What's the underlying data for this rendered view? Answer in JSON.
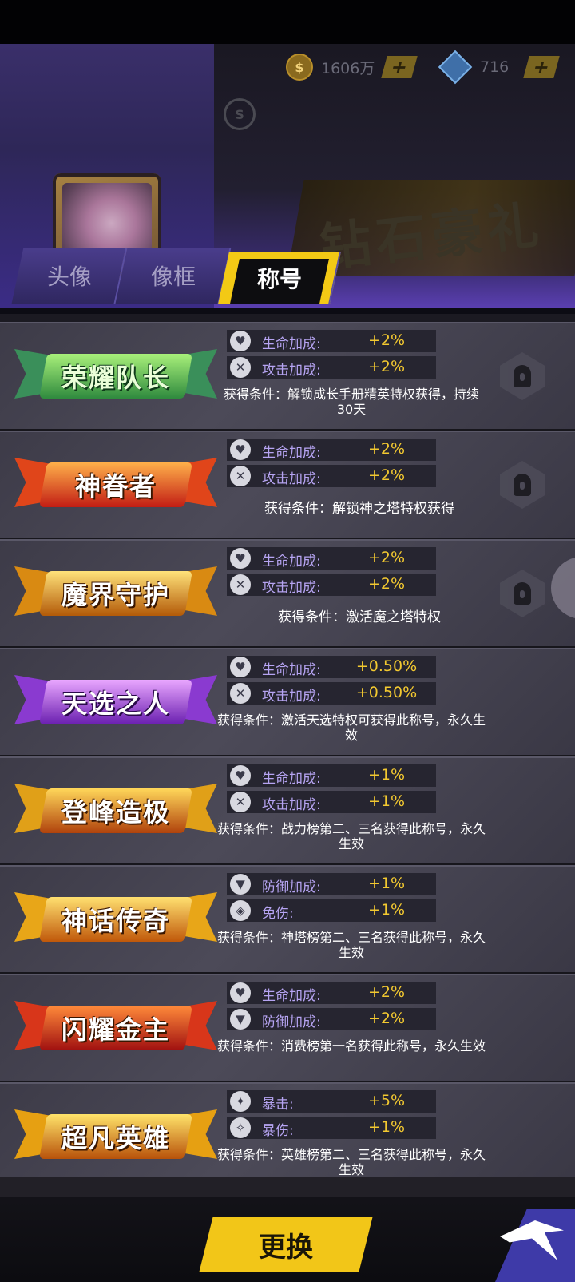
{
  "currency": {
    "coins": "1606万",
    "gems": "716",
    "s_icon": "S"
  },
  "banner": {
    "text": "钻石豪礼"
  },
  "tabs": [
    {
      "label": "头像",
      "active": false
    },
    {
      "label": "像框",
      "active": false
    },
    {
      "label": "称号",
      "active": true
    }
  ],
  "titles": [
    {
      "name": "荣耀队长",
      "locked": true,
      "stats": [
        {
          "icon": "shield-heart-icon",
          "label": "生命加成:",
          "value": "+2%"
        },
        {
          "icon": "crossed-swords-icon",
          "label": "攻击加成:",
          "value": "+2%"
        }
      ],
      "condition": "获得条件：解锁成长手册精英特权获得，持续30天"
    },
    {
      "name": "神眷者",
      "locked": true,
      "stats": [
        {
          "icon": "shield-heart-icon",
          "label": "生命加成:",
          "value": "+2%"
        },
        {
          "icon": "crossed-swords-icon",
          "label": "攻击加成:",
          "value": "+2%"
        }
      ],
      "condition": "获得条件：解锁神之塔特权获得"
    },
    {
      "name": "魔界守护",
      "locked": true,
      "stats": [
        {
          "icon": "shield-heart-icon",
          "label": "生命加成:",
          "value": "+2%"
        },
        {
          "icon": "crossed-swords-icon",
          "label": "攻击加成:",
          "value": "+2%"
        }
      ],
      "condition": "获得条件：激活魔之塔特权"
    },
    {
      "name": "天选之人",
      "locked": false,
      "stats": [
        {
          "icon": "shield-heart-icon",
          "label": "生命加成:",
          "value": "+0.50%"
        },
        {
          "icon": "crossed-swords-icon",
          "label": "攻击加成:",
          "value": "+0.50%"
        }
      ],
      "condition": "获得条件：激活天选特权可获得此称号，永久生效"
    },
    {
      "name": "登峰造极",
      "locked": false,
      "stats": [
        {
          "icon": "shield-heart-icon",
          "label": "生命加成:",
          "value": "+1%"
        },
        {
          "icon": "crossed-swords-icon",
          "label": "攻击加成:",
          "value": "+1%"
        }
      ],
      "condition": "获得条件：战力榜第二、三名获得此称号，永久生效"
    },
    {
      "name": "神话传奇",
      "locked": false,
      "stats": [
        {
          "icon": "shield-icon",
          "label": "防御加成:",
          "value": "+1%"
        },
        {
          "icon": "damage-reduction-icon",
          "label": "免伤:",
          "value": "+1%"
        }
      ],
      "condition": "获得条件：神塔榜第二、三名获得此称号，永久生效"
    },
    {
      "name": "闪耀金主",
      "locked": false,
      "stats": [
        {
          "icon": "shield-heart-icon",
          "label": "生命加成:",
          "value": "+2%"
        },
        {
          "icon": "shield-icon",
          "label": "防御加成:",
          "value": "+2%"
        }
      ],
      "condition": "获得条件：消费榜第一名获得此称号，永久生效"
    },
    {
      "name": "超凡英雄",
      "locked": false,
      "stats": [
        {
          "icon": "critical-icon",
          "label": "暴击:",
          "value": "+5%"
        },
        {
          "icon": "critical-damage-icon",
          "label": "暴伤:",
          "value": "+1%"
        }
      ],
      "condition": "获得条件：英雄榜第二、三名获得此称号，永久生效"
    }
  ],
  "footer": {
    "change_label": "更换"
  }
}
